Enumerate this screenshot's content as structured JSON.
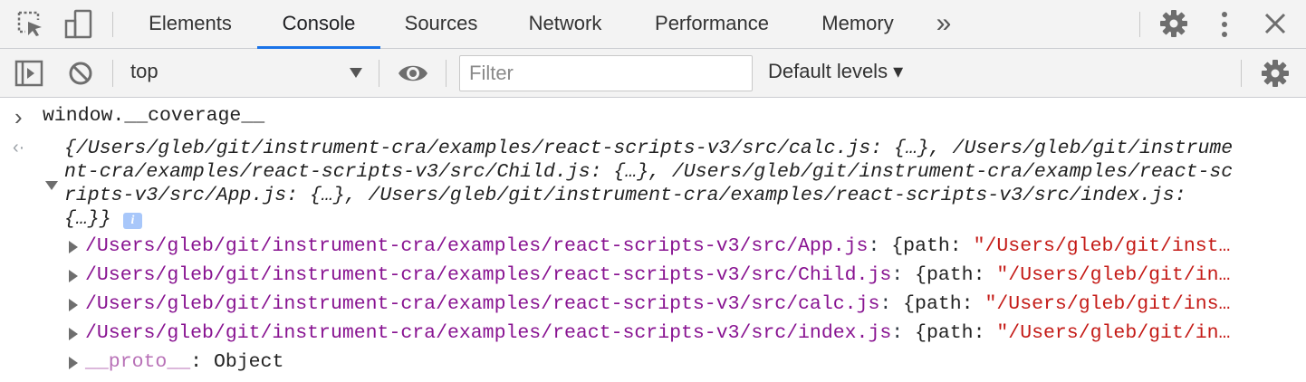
{
  "toolbar": {
    "tabs": [
      {
        "label": "Elements",
        "active": false
      },
      {
        "label": "Console",
        "active": true
      },
      {
        "label": "Sources",
        "active": false
      },
      {
        "label": "Network",
        "active": false
      },
      {
        "label": "Performance",
        "active": false
      },
      {
        "label": "Memory",
        "active": false
      }
    ],
    "more_tabs": "»"
  },
  "console_toolbar": {
    "context": "top",
    "filter_placeholder": "Filter",
    "levels": "Default levels ▾"
  },
  "console": {
    "input_prompt": "›",
    "input_text": "window.__coverage__",
    "result_prompt": "‹·",
    "summary_lines": [
      "{/Users/gleb/git/instrument-cra/examples/react-scripts-v3/src/calc.js: {…}, /Users/gleb/git/instrume",
      "nt-cra/examples/react-scripts-v3/src/Child.js: {…}, /Users/gleb/git/instrument-cra/examples/react-sc",
      "ripts-v3/src/App.js: {…}, /Users/gleb/git/instrument-cra/examples/react-scripts-v3/src/index.js:",
      "{…}}"
    ],
    "info_badge": "i",
    "entries": [
      {
        "key": "/Users/gleb/git/instrument-cra/examples/react-scripts-v3/src/App.js",
        "preview_label": "{path: ",
        "preview_value": "\"/Users/gleb/git/inst…"
      },
      {
        "key": "/Users/gleb/git/instrument-cra/examples/react-scripts-v3/src/Child.js",
        "preview_label": "{path: ",
        "preview_value": "\"/Users/gleb/git/in…"
      },
      {
        "key": "/Users/gleb/git/instrument-cra/examples/react-scripts-v3/src/calc.js",
        "preview_label": "{path: ",
        "preview_value": "\"/Users/gleb/git/ins…"
      },
      {
        "key": "/Users/gleb/git/instrument-cra/examples/react-scripts-v3/src/index.js",
        "preview_label": "{path: ",
        "preview_value": "\"/Users/gleb/git/in…"
      }
    ],
    "proto": {
      "key": "__proto__",
      "value": "Object"
    }
  },
  "colors": {
    "accent": "#1a73e8",
    "property": "#881391",
    "string": "#c41a16"
  }
}
